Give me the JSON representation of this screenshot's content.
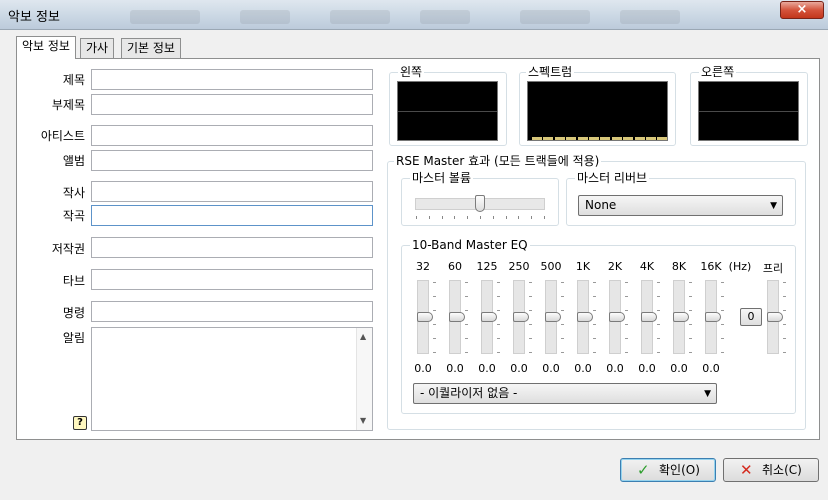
{
  "window": {
    "title": "악보 정보",
    "close_glyph": "×"
  },
  "tabs": [
    {
      "label": "악보 정보",
      "active": true
    },
    {
      "label": "가사",
      "active": false
    },
    {
      "label": "기본 정보",
      "active": false
    }
  ],
  "form": {
    "fields": [
      {
        "label": "제목",
        "value": ""
      },
      {
        "label": "부제목",
        "value": ""
      },
      {
        "label": "아티스트",
        "value": ""
      },
      {
        "label": "앨범",
        "value": ""
      },
      {
        "label": "작사",
        "value": ""
      },
      {
        "label": "작곡",
        "value": ""
      },
      {
        "label": "저작권",
        "value": ""
      },
      {
        "label": "타브",
        "value": ""
      },
      {
        "label": "명령",
        "value": ""
      }
    ],
    "notice": {
      "label": "알림",
      "value": ""
    },
    "help_icon": "?"
  },
  "meters": {
    "left_label": "왼쪽",
    "spectrum_label": "스펙트럼",
    "right_label": "오른쪽"
  },
  "rse": {
    "group_label": "RSE Master 효과 (모든 트랙들에 적용)",
    "volume": {
      "label": "마스터 볼륨",
      "level": 0.5
    },
    "reverb": {
      "label": "마스터 리버브",
      "selected": "None"
    },
    "eq": {
      "label": "10-Band Master EQ",
      "bands": [
        {
          "freq": "32",
          "value": "0.0"
        },
        {
          "freq": "60",
          "value": "0.0"
        },
        {
          "freq": "125",
          "value": "0.0"
        },
        {
          "freq": "250",
          "value": "0.0"
        },
        {
          "freq": "500",
          "value": "0.0"
        },
        {
          "freq": "1K",
          "value": "0.0"
        },
        {
          "freq": "2K",
          "value": "0.0"
        },
        {
          "freq": "4K",
          "value": "0.0"
        },
        {
          "freq": "8K",
          "value": "0.0"
        },
        {
          "freq": "16K",
          "value": "0.0"
        }
      ],
      "hz_label": "(Hz)",
      "zero_button": "0",
      "pre_label": "프리",
      "preset": "- 이퀄라이저 없음 -"
    }
  },
  "buttons": {
    "ok": {
      "label": "확인(O)",
      "icon": "✓"
    },
    "cancel": {
      "label": "취소(C)",
      "icon": "✕"
    }
  },
  "colors": {
    "ok_icon": "#2e9e2e",
    "cancel_icon": "#d42a1e",
    "meter_bg": "#000000"
  }
}
